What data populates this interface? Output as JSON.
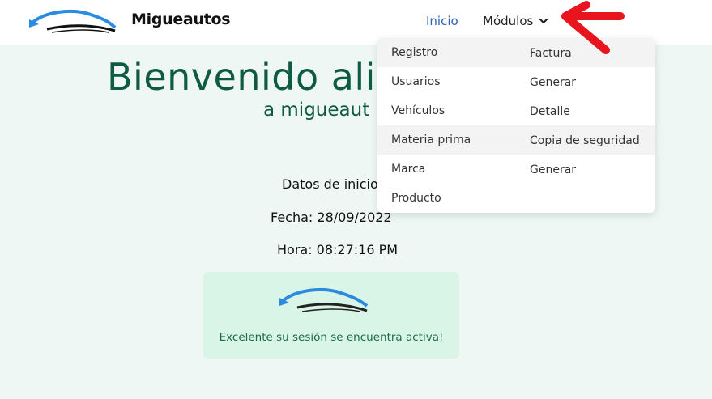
{
  "navbar": {
    "brand": "Migueautos",
    "inicio": "Inicio",
    "modulos": "Módulos"
  },
  "welcome": {
    "title": "Bienvenido ali",
    "subtitle": "a migueaut",
    "datos": "Datos de inicio",
    "fecha": "Fecha: 28/09/2022",
    "hora": "Hora: 08:27:16 PM"
  },
  "alert": {
    "message": "Excelente su sesión se encuentra activa!"
  },
  "dropdown": {
    "left": [
      "Registro",
      "Usuarios",
      "Vehículos",
      "Materia prima",
      "Marca",
      "Producto"
    ],
    "right": [
      "Factura",
      "Generar",
      "Detalle",
      "Copia de seguridad",
      "Generar"
    ]
  },
  "colors": {
    "accent": "#2f62b5",
    "heading": "#0f5a43",
    "alert_bg": "#d9f5e7",
    "annotation": "#e8141e"
  },
  "icons": [
    "car-logo-icon",
    "chevron-down-icon",
    "red-arrow-annotation"
  ]
}
